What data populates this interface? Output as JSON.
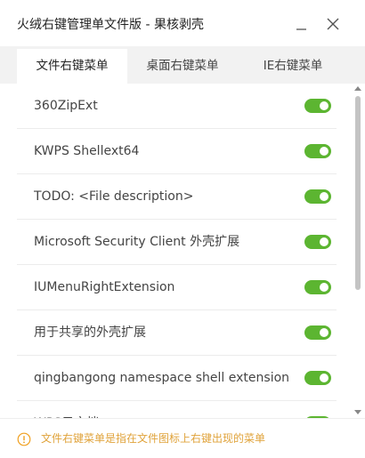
{
  "window": {
    "title": "火绒右键管理单文件版 - 果核剥壳"
  },
  "tabs": [
    {
      "label": "文件右键菜单",
      "active": true
    },
    {
      "label": "桌面右键菜单",
      "active": false
    },
    {
      "label": "IE右键菜单",
      "active": false
    }
  ],
  "items": [
    {
      "label": "360ZipExt",
      "enabled": true
    },
    {
      "label": "KWPS Shellext64",
      "enabled": true
    },
    {
      "label": "TODO: <File description>",
      "enabled": true
    },
    {
      "label": "Microsoft Security Client 外壳扩展",
      "enabled": true
    },
    {
      "label": "IUMenuRightExtension",
      "enabled": true
    },
    {
      "label": "用于共享的外壳扩展",
      "enabled": true
    },
    {
      "label": "qingbangong namespace shell extension",
      "enabled": true
    },
    {
      "label": "WPS云文档",
      "enabled": true
    }
  ],
  "footer": {
    "hint": "文件右键菜单是指在文件图标上右键出现的菜单"
  },
  "colors": {
    "toggle_on": "#5cb531",
    "hint_text": "#e0a33b",
    "info_icon": "#f0a020"
  },
  "icons": {
    "minimize": "minimize-icon",
    "close": "close-icon",
    "info": "info-icon"
  }
}
